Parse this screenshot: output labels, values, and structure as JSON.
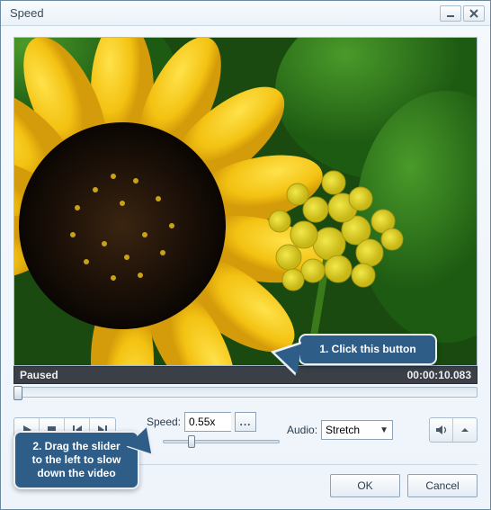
{
  "window": {
    "title": "Speed"
  },
  "status": {
    "state": "Paused",
    "time": "00:00:10.083"
  },
  "playback": {
    "icons": {
      "play": "play-icon",
      "stop": "stop-icon",
      "prev": "skip-back-icon",
      "next": "skip-forward-icon"
    }
  },
  "speed": {
    "label": "Speed:",
    "value": "0.55x",
    "more_label": "...",
    "slider_position_pct": 23
  },
  "audio": {
    "label": "Audio:",
    "selected": "Stretch"
  },
  "volume": {
    "icons": {
      "speaker": "speaker-icon",
      "expand": "chevron-up-icon"
    }
  },
  "actions": {
    "ok": "OK",
    "cancel": "Cancel"
  },
  "callouts": {
    "c1": "1. Click this button",
    "c2": "2. Drag the slider to the left to slow down the video"
  }
}
